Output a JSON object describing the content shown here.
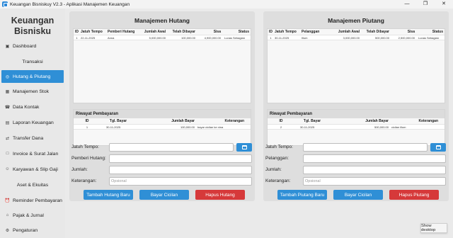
{
  "window": {
    "title": "Keuangan Bisniskuy V2.3 - Aplikasi Manajemen Keuangan",
    "controls": [
      "—",
      "❐",
      "✕"
    ]
  },
  "sidebar": {
    "logo_line1": "Keuangan",
    "logo_line2": "Bisnisku",
    "items": [
      {
        "label": "Dashboard",
        "icon": "home-icon",
        "glyph": "▣"
      },
      {
        "label": "Transaksi",
        "icon": "",
        "glyph": ""
      },
      {
        "label": "Hutang & Piutang",
        "icon": "hutang-icon",
        "glyph": "◎"
      },
      {
        "label": "Manajemen Stok",
        "icon": "stock-icon",
        "glyph": "▦"
      },
      {
        "label": "Data Kontak",
        "icon": "contact-icon",
        "glyph": "☎"
      },
      {
        "label": "Laporan Keuangan",
        "icon": "report-icon",
        "glyph": "▤"
      },
      {
        "label": "Transfer Dana",
        "icon": "transfer-icon",
        "glyph": "⇄"
      },
      {
        "label": "Invoice & Surat Jalan",
        "icon": "invoice-icon",
        "glyph": "□"
      },
      {
        "label": "Karyawan & Slip Gaji",
        "icon": "employee-icon",
        "glyph": "☺"
      },
      {
        "label": "Aset & Ekuitas",
        "icon": "",
        "glyph": ""
      },
      {
        "label": "Reminder Pembayaran",
        "icon": "reminder-icon",
        "glyph": "⏰"
      },
      {
        "label": "Pajak & Jurnal",
        "icon": "tax-icon",
        "glyph": "⌂"
      },
      {
        "label": "Pengaturan",
        "icon": "settings-icon",
        "glyph": "⚙"
      }
    ]
  },
  "hutang": {
    "title": "Manajemen Hutang",
    "columns": [
      "ID",
      "Jatuh Tempo",
      "Pemberi Hutang",
      "Jumlah Awal",
      "Telah Dibayar",
      "Sisa",
      "Status"
    ],
    "rows": [
      [
        "1",
        "22-11-2025",
        "Anna",
        "5,000,000.00",
        "100,000.00",
        "4,900,000.00",
        "Lunas Sebagian"
      ]
    ],
    "riwayat_title": "Riwayat Pembayaran",
    "riwayat_columns": [
      "ID",
      "Tgl. Bayar",
      "Jumlah Bayar",
      "Keterangan"
    ],
    "riwayat_rows": [
      [
        "1",
        "30-11-2025",
        "100,000.00",
        "bayar cicilan ke nina"
      ]
    ],
    "form": {
      "jatuh_tempo_label": "Jatuh Tempo:",
      "pemberi_label": "Pemberi Hutang:",
      "jumlah_label": "Jumlah:",
      "keterangan_label": "Keterangan:",
      "keterangan_placeholder": "Opsional"
    },
    "buttons": {
      "tambah": "Tambah Hutang Baru",
      "bayar": "Bayar Cicilan",
      "hapus": "Hapus Hutang"
    }
  },
  "piutang": {
    "title": "Manajemen Piutang",
    "columns": [
      "ID",
      "Jatuh Tempo",
      "Pelanggan",
      "Jumlah Awal",
      "Telah Dibayar",
      "Sisa",
      "Status"
    ],
    "rows": [
      [
        "1",
        "30-11-2025",
        "Illum",
        "3,000,000.00",
        "500,000.00",
        "2,500,000.00",
        "Lunas Sebagian"
      ]
    ],
    "riwayat_title": "Riwayat Pembayaran",
    "riwayat_columns": [
      "ID",
      "Tgl. Bayar",
      "Jumlah Bayar",
      "Keterangan"
    ],
    "riwayat_rows": [
      [
        "2",
        "30-11-2025",
        "500,000.00",
        "cicilan illum"
      ]
    ],
    "form": {
      "jatuh_tempo_label": "Jatuh Tempo:",
      "pelanggan_label": "Pelanggan:",
      "jumlah_label": "Jumlah:",
      "keterangan_label": "Keterangan:",
      "keterangan_placeholder": "Opsional"
    },
    "buttons": {
      "tambah": "Tambah Piutang Baru",
      "bayar": "Bayar Cicilan",
      "hapus": "Hapus Piutang"
    }
  },
  "tooltip": "Show desktop",
  "colors": {
    "accent": "#2f8fd6",
    "danger": "#d6393a"
  }
}
